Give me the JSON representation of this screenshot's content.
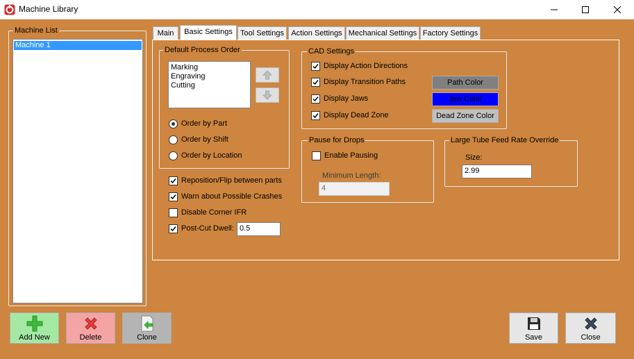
{
  "window": {
    "title": "Machine Library",
    "icon": "app-logo-icon"
  },
  "machine_list": {
    "legend": "Machine List",
    "items": [
      "Machine 1"
    ],
    "selected": "Machine 1"
  },
  "tabs": [
    "Main",
    "Basic Settings",
    "Tool Settings",
    "Action Settings",
    "Mechanical Settings",
    "Factory Settings"
  ],
  "active_tab": "Basic Settings",
  "process_order": {
    "legend": "Default Process Order",
    "items": [
      "Marking",
      "Engraving",
      "Cutting"
    ],
    "radios": [
      {
        "label": "Order by Part",
        "selected": true
      },
      {
        "label": "Order by Shift",
        "selected": false
      },
      {
        "label": "Order by Location",
        "selected": false
      }
    ]
  },
  "options": {
    "reposition": {
      "label": "Reposition/Flip between parts",
      "checked": true
    },
    "warn_crashes": {
      "label": "Warn about Possible Crashes",
      "checked": true
    },
    "disable_corner": {
      "label": "Disable Corner IFR",
      "checked": false
    },
    "post_cut_dwell": {
      "label": "Post-Cut Dwell:",
      "checked": true,
      "value": "0.5"
    }
  },
  "cad": {
    "legend": "CAD Settings",
    "action_dirs": {
      "label": "Display Action Directions",
      "checked": true
    },
    "transition_paths": {
      "label": "Display Transition Paths",
      "checked": true
    },
    "jaws": {
      "label": "Display Jaws",
      "checked": true
    },
    "dead_zone": {
      "label": "Display Dead Zone",
      "checked": true
    },
    "path_color": {
      "label": "Path Color",
      "color": "#808080"
    },
    "jaw_color": {
      "label": "Jaw Color",
      "color": "#0000ff"
    },
    "dead_zone_color": {
      "label": "Dead Zone Color",
      "color": "#c0c0c0"
    }
  },
  "pause": {
    "legend": "Pause for Drops",
    "enable": {
      "label": "Enable Pausing",
      "checked": false
    },
    "min_length_label": "Minimum Length:",
    "min_length_value": "4"
  },
  "tube": {
    "legend": "Large Tube Feed Rate Override",
    "size_label": "Size:",
    "size_value": "2.99"
  },
  "buttons": {
    "add_new": "Add New",
    "delete": "Delete",
    "clone": "Clone",
    "save": "Save",
    "close": "Close"
  },
  "colors": {
    "background": "#cd853f",
    "add_new_bg": "#a4e8a4",
    "delete_bg": "#f4a4a4",
    "clone_bg": "#b4b4b4",
    "button_bg": "#e6e6e6"
  }
}
